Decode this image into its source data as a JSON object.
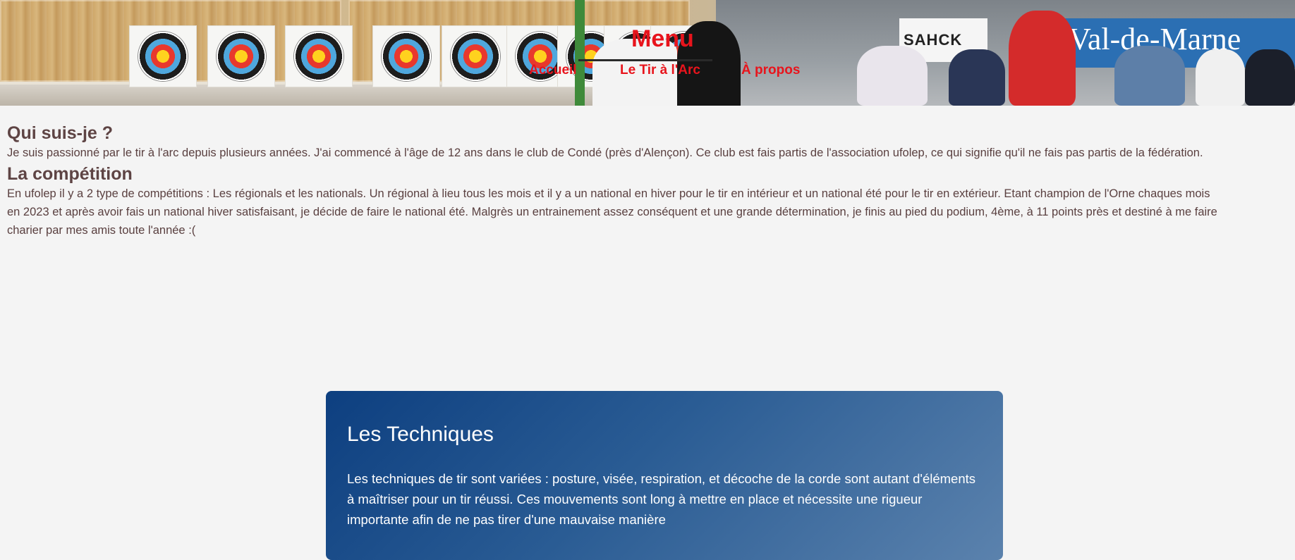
{
  "header": {
    "banner_signs": {
      "sponsor": "SAHCK",
      "region": "Val-de-Marne"
    },
    "menu_title": "Menu",
    "nav": [
      {
        "label": "Accueil"
      },
      {
        "label": "Le Tir à l'Arc"
      },
      {
        "label": "À propos"
      }
    ]
  },
  "sections": [
    {
      "heading": "Qui suis-je ?",
      "text": "Je suis passionné par le tir à l'arc depuis plusieurs années. J'ai commencé à l'âge de 12 ans dans le club de Condé (près d'Alençon). Ce club est fais partis de l'association ufolep, ce qui signifie qu'il ne fais pas partis de la fédération."
    },
    {
      "heading": "La compétition",
      "text": "En ufolep il y a 2 type de compétitions : Les régionals et les nationals. Un régional à lieu tous les mois et il y a un national en hiver pour le tir en intérieur et un national été pour le tir en extérieur. Etant champion de l'Orne chaques mois en 2023 et après avoir fais un national hiver satisfaisant, je décide de faire le national été. Malgrès un entrainement assez conséquent et une grande détermination, je finis au pied du podium, 4ème, à 11 points près et destiné à me faire charier par mes amis toute l'année :("
    }
  ],
  "card": {
    "title": "Les Techniques",
    "text": "Les techniques de tir sont variées : posture, visée, respiration, et décoche de la corde sont autant d'éléments à maîtriser pour un tir réussi. Ces mouvements sont long à mettre en place et nécessite une rigueur importante afin de ne pas tirer d'une mauvaise manière"
  },
  "colors": {
    "nav": "#e8141c",
    "text": "#5a4040",
    "background": "#f4f4f4",
    "card_start": "#0d3f80",
    "card_end": "#5b82ad"
  }
}
